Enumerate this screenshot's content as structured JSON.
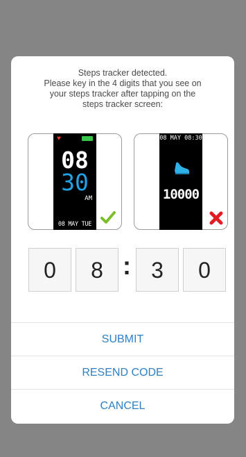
{
  "dialog": {
    "message_lines": [
      "Steps tracker detected.",
      "Please key in the 4 digits that you see on",
      "your steps tracker after tapping on the",
      "steps tracker screen:"
    ],
    "option_correct": {
      "hour": "08",
      "minute": "30",
      "ampm": "AM",
      "date": "08 MAY TUE",
      "mark": "check-icon"
    },
    "option_wrong": {
      "datetime": "08 MAY 08:30",
      "steps": "10000",
      "mark": "cross-icon"
    },
    "code_digits": [
      "0",
      "8",
      "3",
      "0"
    ],
    "separator": ":",
    "buttons": {
      "submit": "SUBMIT",
      "resend": "RESEND CODE",
      "cancel": "CANCEL"
    }
  },
  "colors": {
    "backdrop": "#858585",
    "accent": "#2d80c6",
    "minute_digits": "#1fa3e8",
    "check": "#7bbf2a",
    "cross": "#e31b23"
  }
}
